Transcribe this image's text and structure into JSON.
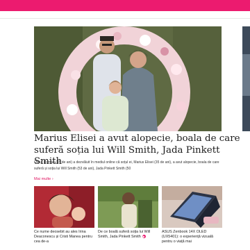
{
  "header": {
    "brand_color": "#ec1b6f"
  },
  "main_article": {
    "title": "Marius Elisei a avut alopecie, boala de care suferă soția lui Will Smith, Jada Pinkett Smith",
    "lede": "Oana Roman (45 de ani) a dezvăluit în mediul online că soțul ei, Marius Elisei (35 de ani), a avut alopecie, boala de care suferă și soția lui Will Smith (53 de ani), Jada Pinkett Smith (50",
    "more_label": "Mai multe",
    "more_icon": "chevron-right-icon"
  },
  "cards": [
    {
      "title": "Ce nume deosebit au ales Irina Deaconescu și Cristi Manea pentru cea de-a"
    },
    {
      "title": "De ce boală suferă soția lui Will Smith, Jada Pinkett Smith",
      "badge_icon": "play-icon"
    },
    {
      "title": "ASUS Zenbook 14X OLED (UX5401): o experiență vizuală pentru o viață mai"
    }
  ]
}
